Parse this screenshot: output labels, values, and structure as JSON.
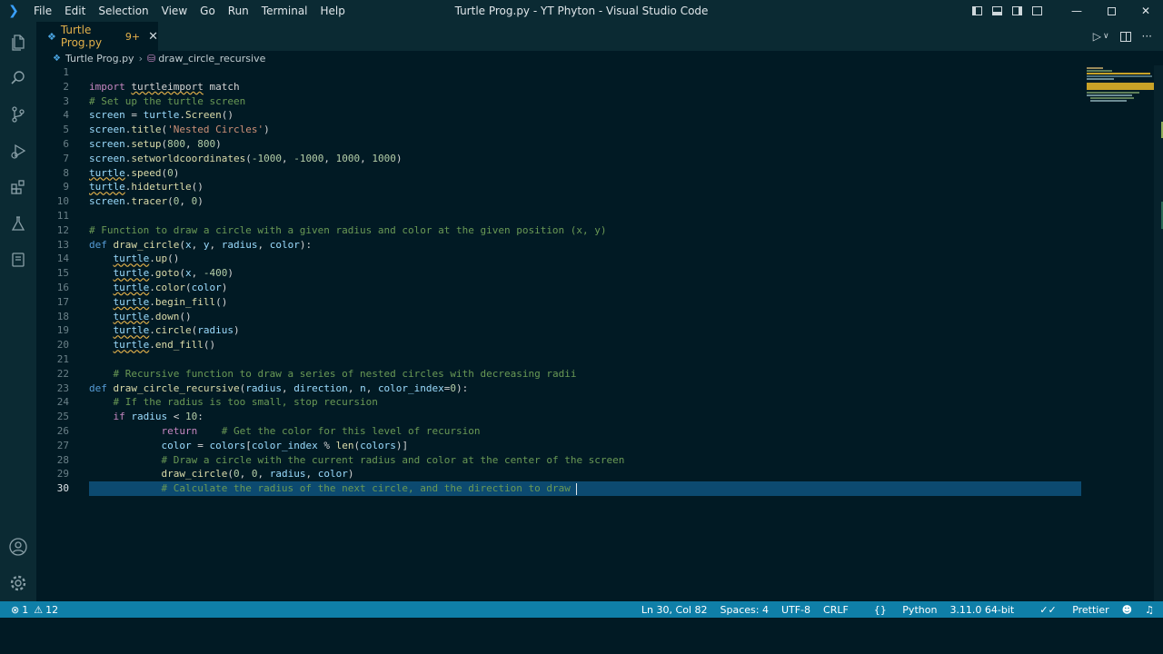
{
  "window": {
    "title": "Turtle Prog.py - YT Phyton - Visual Studio Code",
    "menu": [
      "File",
      "Edit",
      "Selection",
      "View",
      "Go",
      "Run",
      "Terminal",
      "Help"
    ]
  },
  "tab": {
    "name": "Turtle Prog.py",
    "problems": "9+"
  },
  "breadcrumb": {
    "file": "Turtle Prog.py",
    "symbol": "draw_circle_recursive"
  },
  "status": {
    "errors": "1",
    "warnings": "12",
    "position": "Ln 30, Col 82",
    "spaces": "Spaces: 4",
    "encoding": "UTF-8",
    "eol": "CRLF",
    "language": "Python",
    "interpreter": "3.11.0 64-bit",
    "formatter": "Prettier"
  },
  "code": {
    "ln": [
      "1",
      "2",
      "3",
      "4",
      "5",
      "6",
      "7",
      "8",
      "9",
      "10",
      "11",
      "12",
      "13",
      "14",
      "15",
      "16",
      "17",
      "18",
      "19",
      "20",
      "21",
      "22",
      "23",
      "24",
      "25",
      "26",
      "27",
      "28",
      "29",
      "30"
    ],
    "l2a": "import",
    "l2b": "turtleimport",
    "l2c": "match",
    "l3": "# Set up the turtle screen",
    "l4a": "screen",
    "l4b": " = ",
    "l4c": "turtle",
    "l4d": ".",
    "l4e": "Screen",
    "l4f": "()",
    "l5a": "screen",
    "l5b": ".",
    "l5c": "title",
    "l5d": "(",
    "l5e": "'Nested Circles'",
    "l5f": ")",
    "l6a": "screen",
    "l6b": ".",
    "l6c": "setup",
    "l6d": "(",
    "l6e": "800",
    "l6f": ", ",
    "l6g": "800",
    "l6h": ")",
    "l7a": "screen",
    "l7b": ".",
    "l7c": "setworldcoordinates",
    "l7d": "(",
    "l7e": "-1000",
    "l7f": ", ",
    "l7g": "-1000",
    "l7h": ", ",
    "l7i": "1000",
    "l7j": ", ",
    "l7k": "1000",
    "l7l": ")",
    "l8a": "turtle",
    "l8b": ".",
    "l8c": "speed",
    "l8d": "(",
    "l8e": "0",
    "l8f": ")",
    "l9a": "turtle",
    "l9b": ".",
    "l9c": "hideturtle",
    "l9d": "()",
    "l10a": "screen",
    "l10b": ".",
    "l10c": "tracer",
    "l10d": "(",
    "l10e": "0",
    "l10f": ", ",
    "l10g": "0",
    "l10h": ")",
    "l12": "# Function to draw a circle with a given radius and color at the given position (x, y)",
    "l13a": "def",
    "l13b": "draw_circle",
    "l13c": "(",
    "l13d": "x",
    "l13e": ", ",
    "l13f": "y",
    "l13g": ", ",
    "l13h": "radius",
    "l13i": ", ",
    "l13j": "color",
    "l13k": "):",
    "l14a": "turtle",
    "l14b": ".",
    "l14c": "up",
    "l14d": "()",
    "l15a": "turtle",
    "l15b": ".",
    "l15c": "goto",
    "l15d": "(",
    "l15e": "x",
    "l15f": ", ",
    "l15g": "-400",
    "l15h": ")",
    "l16a": "turtle",
    "l16b": ".",
    "l16c": "color",
    "l16d": "(",
    "l16e": "color",
    "l16f": ")",
    "l17a": "turtle",
    "l17b": ".",
    "l17c": "begin_fill",
    "l17d": "()",
    "l18a": "turtle",
    "l18b": ".",
    "l18c": "down",
    "l18d": "()",
    "l19a": "turtle",
    "l19b": ".",
    "l19c": "circle",
    "l19d": "(",
    "l19e": "radius",
    "l19f": ")",
    "l20a": "turtle",
    "l20b": ".",
    "l20c": "end_fill",
    "l20d": "()",
    "l22": "# Recursive function to draw a series of nested circles with decreasing radii",
    "l23a": "def",
    "l23b": "draw_circle_recursive",
    "l23c": "(",
    "l23d": "radius",
    "l23e": ", ",
    "l23f": "direction",
    "l23g": ", ",
    "l23h": "n",
    "l23i": ", ",
    "l23j": "color_index",
    "l23k": "=",
    "l23l": "0",
    "l23m": "):",
    "l24": "# If the radius is too small, stop recursion",
    "l25a": "if",
    "l25b": "radius",
    "l25c": " < ",
    "l25d": "10",
    "l25e": ":",
    "l26a": "return",
    "l26b": "# Get the color for this level of recursion",
    "l27a": "color",
    "l27b": " = ",
    "l27c": "colors",
    "l27d": "[",
    "l27e": "color_index",
    "l27f": " % ",
    "l27g": "len",
    "l27h": "(",
    "l27i": "colors",
    "l27j": ")]",
    "l28": "# Draw a circle with the current radius and color at the center of the screen",
    "l29a": "draw_circle",
    "l29b": "(",
    "l29c": "0",
    "l29d": ", ",
    "l29e": "0",
    "l29f": ", ",
    "l29g": "radius",
    "l29h": ", ",
    "l29i": "color",
    "l29j": ")",
    "l30": "# Calculate the radius of the next circle, and the direction to draw "
  }
}
